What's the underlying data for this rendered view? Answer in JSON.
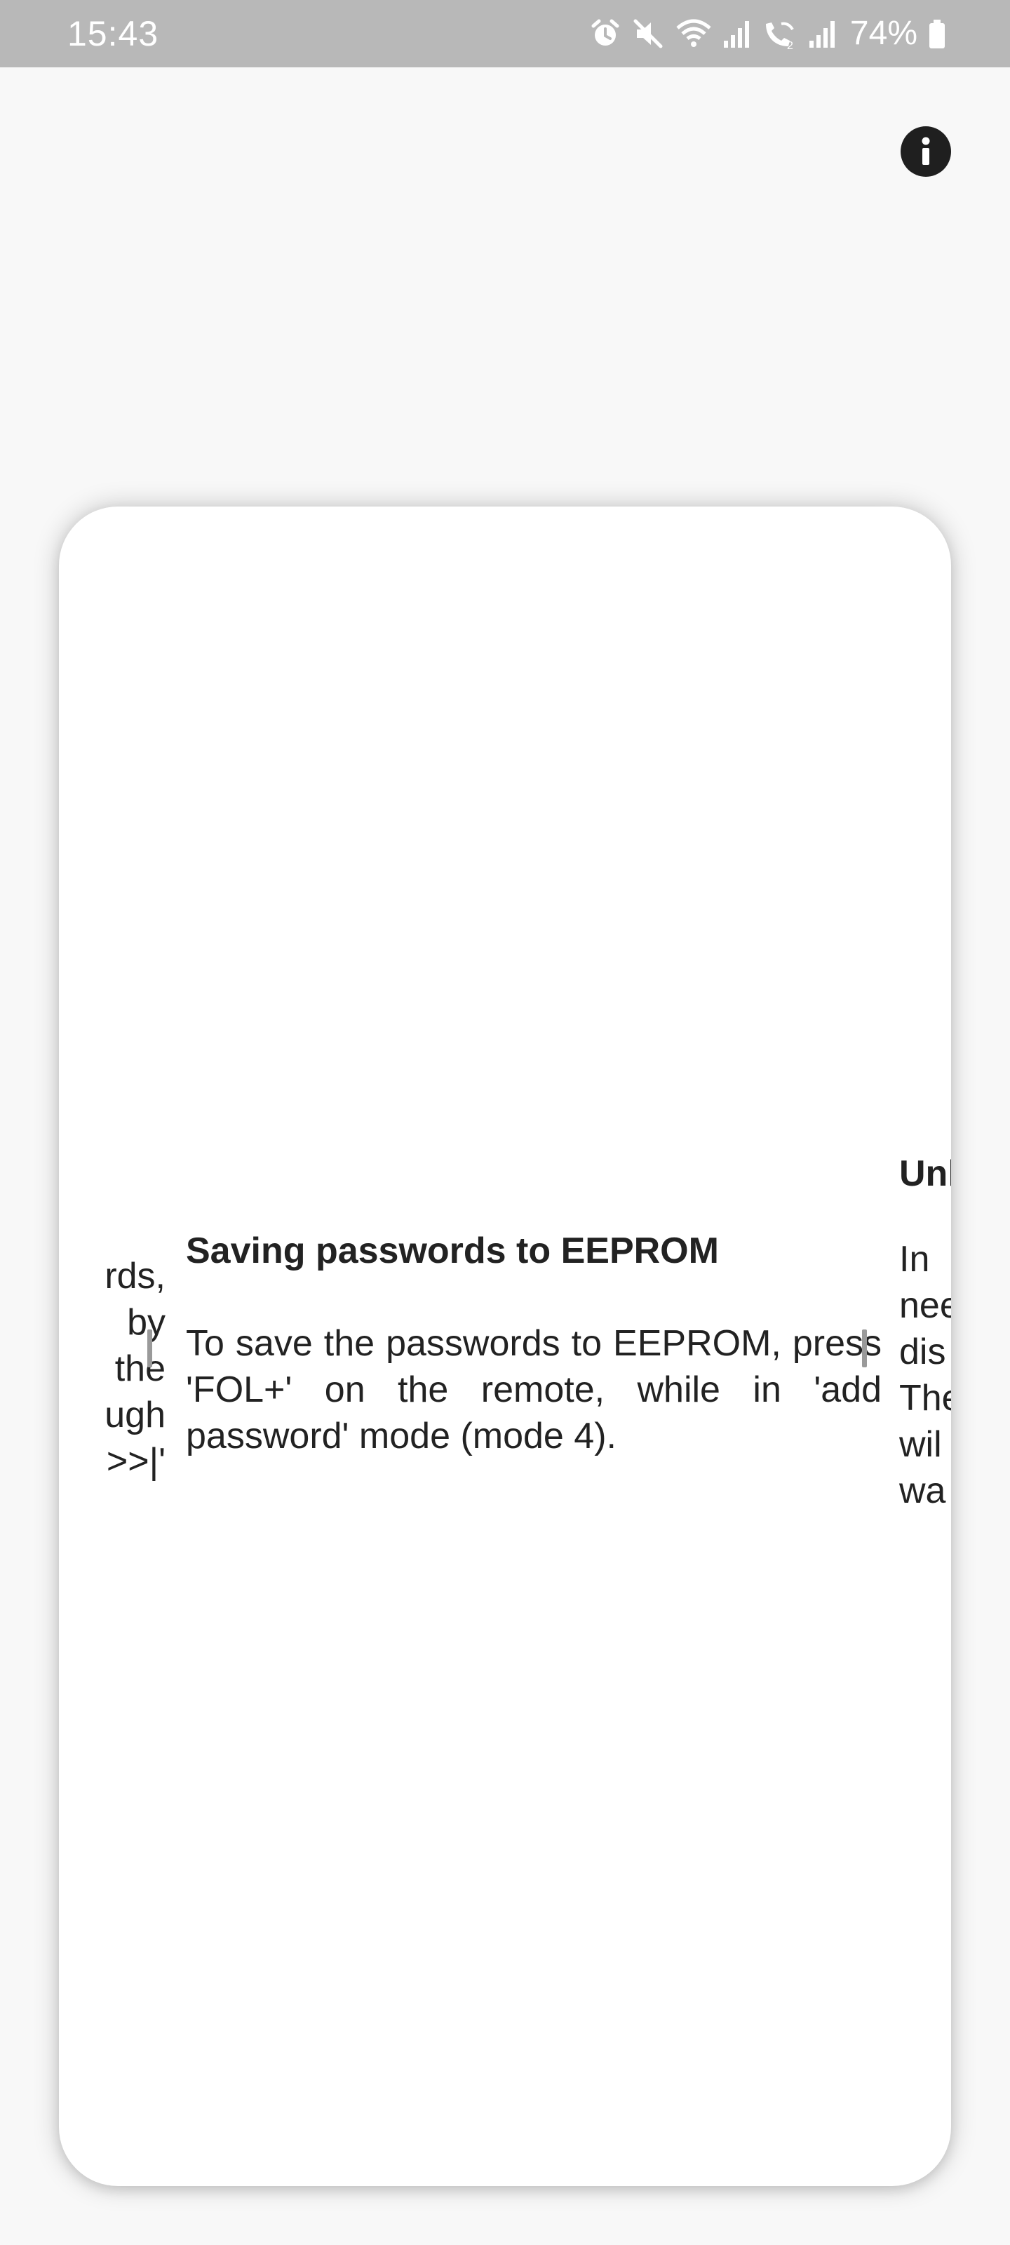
{
  "status_bar": {
    "time": "15:43",
    "battery_percent": "74%",
    "icons": [
      "alarm-icon",
      "mute-icon",
      "wifi-calling-icon",
      "signal-icon",
      "wifi-calling-2-icon",
      "signal-2-icon",
      "battery-icon"
    ]
  },
  "header": {
    "info_icon": "info-icon"
  },
  "slides": {
    "previous": {
      "body_lines": [
        "rds,",
        "by",
        "the",
        "ugh",
        ">>|'"
      ]
    },
    "current": {
      "title": "Saving passwords to EEPROM",
      "body": "To save the passwords to EEPROM, press 'FOL+' on the remote, while in 'add password' mode (mode 4)."
    },
    "next": {
      "title": "Unl",
      "body_lines": [
        "In",
        "nee",
        "dis",
        "The",
        "wil",
        "wa"
      ]
    }
  },
  "colors": {
    "status_bar_bg": "#b8b8b8",
    "page_bg": "#f8f8f8",
    "card_bg": "#ffffff",
    "text": "#222222",
    "divider": "#9a9a9a",
    "info_button_bg": "#1f1f1f"
  }
}
